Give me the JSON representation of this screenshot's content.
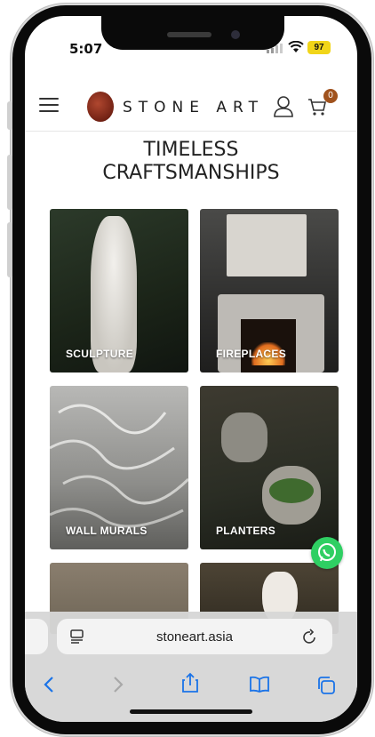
{
  "status_bar": {
    "time": "5:07",
    "battery": "97"
  },
  "header": {
    "logo_text": "STONE ART",
    "cart_count": "0"
  },
  "page_title": "TIMELESS\nCRAFTSMANSHIPS",
  "categories": [
    {
      "label": "SCULPTURE"
    },
    {
      "label": "FIREPLACES"
    },
    {
      "label": "WALL MURALS"
    },
    {
      "label": "PLANTERS"
    }
  ],
  "browser": {
    "url": "stoneart.asia"
  },
  "colors": {
    "accent": "#a0521d",
    "battery": "#f1d519",
    "ios_blue": "#1a73e8",
    "whatsapp": "#2fcf63"
  },
  "icons": [
    "menu-icon",
    "user-icon",
    "cart-icon",
    "whatsapp-icon",
    "reader-icon",
    "reload-icon",
    "back-icon",
    "forward-icon",
    "share-icon",
    "bookmarks-icon",
    "tabs-icon"
  ]
}
